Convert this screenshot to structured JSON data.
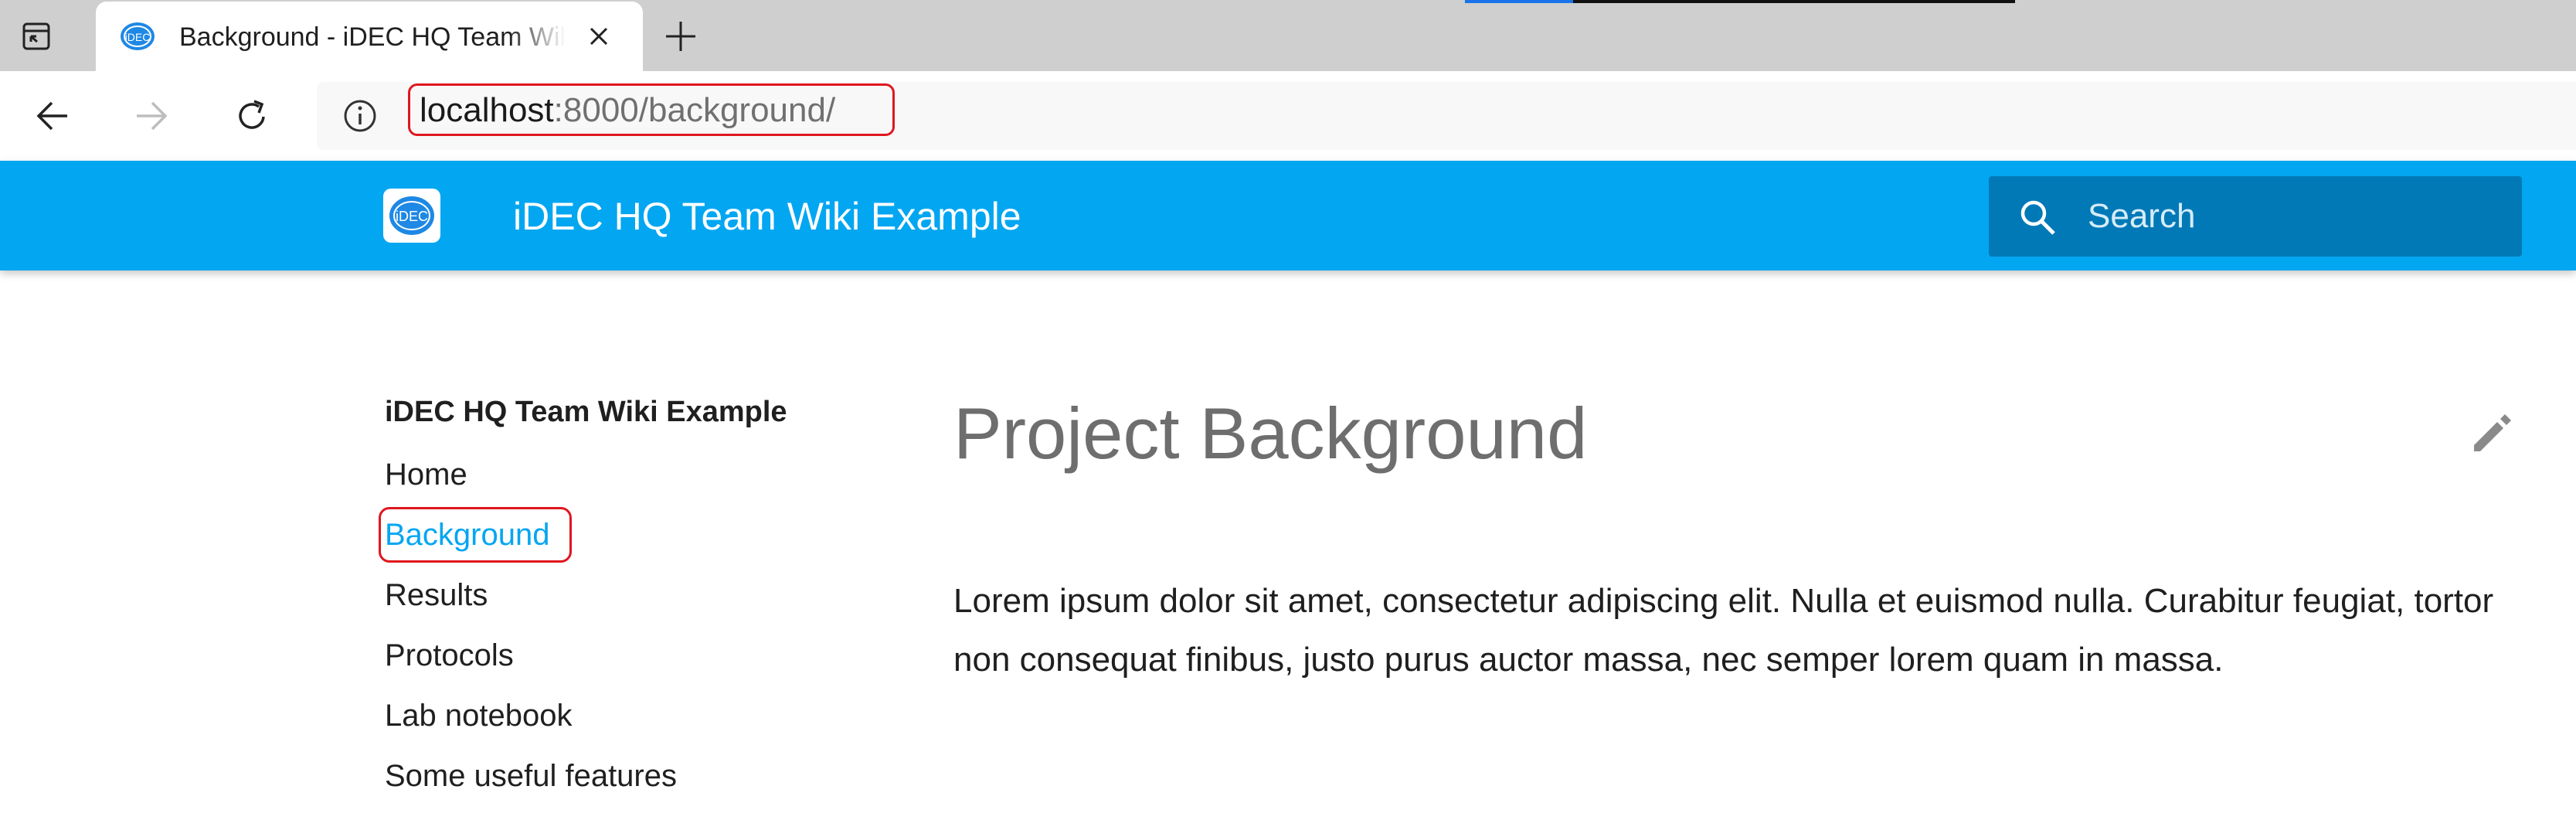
{
  "browser": {
    "tab": {
      "title": "Background - iDEC HQ Team Wiki Example",
      "favicon_text": "iDEC"
    },
    "address_bar": {
      "url_host": "localhost",
      "url_rest": ":8000/background/"
    },
    "icons": {
      "tab_actions": "tab-actions-icon",
      "close": "close-icon",
      "new_tab": "plus-icon",
      "back": "arrow-left-icon",
      "forward": "arrow-right-icon",
      "reload": "reload-icon",
      "info": "info-icon"
    }
  },
  "site": {
    "logo_text": "iDEC",
    "title": "iDEC HQ Team Wiki Example",
    "search": {
      "placeholder": "Search"
    },
    "colors": {
      "header": "#03a6f1",
      "search_box": "#0279b7",
      "active_link": "#03a6f1"
    }
  },
  "sidebar": {
    "heading": "iDEC HQ Team Wiki Example",
    "items": [
      {
        "label": "Home"
      },
      {
        "label": "Background",
        "active": true
      },
      {
        "label": "Results"
      },
      {
        "label": "Protocols"
      },
      {
        "label": "Lab notebook"
      },
      {
        "label": "Some useful features"
      }
    ]
  },
  "main": {
    "title": "Project Background",
    "paragraph": "Lorem ipsum dolor sit amet, consectetur adipiscing elit. Nulla et euismod nulla. Curabitur feugiat, tortor non consequat finibus, justo purus auctor massa, nec semper lorem quam in massa."
  }
}
